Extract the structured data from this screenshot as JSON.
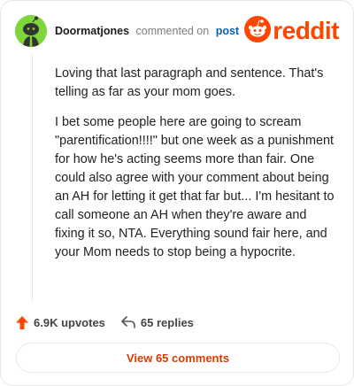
{
  "comment": {
    "username": "Doormatjones",
    "action_text": "commented on",
    "post_link": "post",
    "paragraphs": [
      "Loving that last paragraph and sentence. That's telling as far as your mom goes.",
      "I bet some people here are going to scream \"parentification!!!!\" but one week as a punishment for how he's acting seems more than fair. One could also agree with your comment about being an AH for letting it get that far but... I'm hesitant to call someone an AH when they're aware and fixing it so, NTA. Everything sound fair here, and your Mom needs to stop being a hypocrite."
    ]
  },
  "brand": {
    "wordmark": "reddit",
    "color": "#ff4500"
  },
  "actions": {
    "upvotes_label": "6.9K upvotes",
    "replies_label": "65 replies",
    "upvote_color": "#ff4500"
  },
  "view_comments": {
    "label": "View 65 comments",
    "color": "#d93a00"
  },
  "icons": {
    "avatar": "snoo-avatar-icon",
    "logo": "reddit-snoo-icon",
    "upvote": "upvote-arrow-icon",
    "reply": "reply-arrow-icon"
  }
}
